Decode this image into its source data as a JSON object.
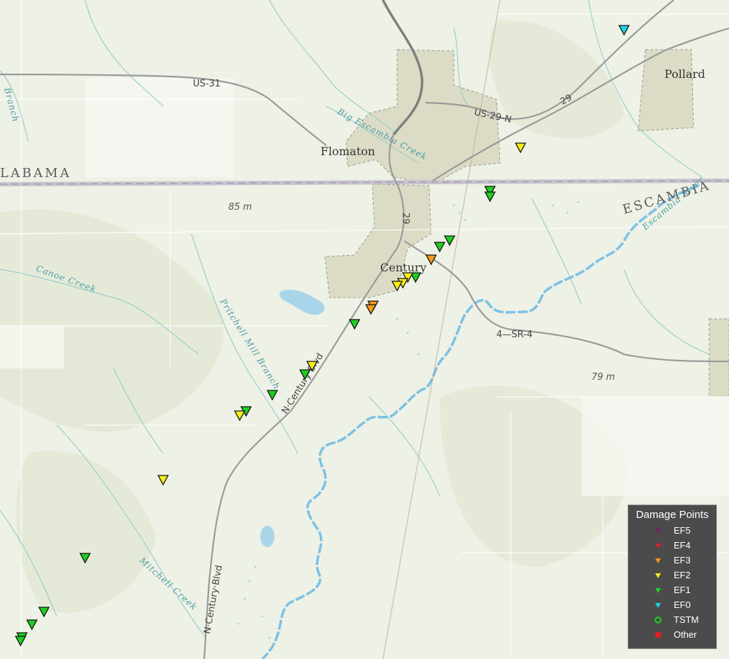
{
  "map": {
    "places": {
      "pollard": "Pollard",
      "flomaton": "Flomaton",
      "century": "Century",
      "state_label": "LABAMA",
      "escambia_county": "ESCAMBIA"
    },
    "roads": {
      "us31": "US-31",
      "us29n": "US-29-N",
      "r29_ne": "29",
      "r29_s": "29",
      "sr4": "4—SR-4",
      "n_century_blvd_1": "N·Century·Blvd",
      "n_century_blvd_2": "N·Century·Blvd"
    },
    "water": {
      "big_escambia_creek": "Big Escambia Creek",
      "canoe_creek": "Canoe Creek",
      "pritchell_mill_branch": "Pritchell Mill Branch",
      "mitchell_creek": "Mitchell Creek",
      "escambia_river": "Escambia River",
      "branch": "Branch"
    },
    "elevations": {
      "e85": "85 m",
      "e79": "79 m"
    }
  },
  "legend": {
    "title": "Damage Points",
    "items": [
      {
        "label": "EF5",
        "color": "#7b1f5f",
        "shape": "triangle"
      },
      {
        "label": "EF4",
        "color": "#e0201e",
        "shape": "triangle"
      },
      {
        "label": "EF3",
        "color": "#f59a19",
        "shape": "triangle"
      },
      {
        "label": "EF2",
        "color": "#f5ee19",
        "shape": "triangle"
      },
      {
        "label": "EF1",
        "color": "#1fce20",
        "shape": "triangle"
      },
      {
        "label": "EF0",
        "color": "#19d6e6",
        "shape": "triangle"
      },
      {
        "label": "TSTM",
        "color": "#19d61f",
        "shape": "ring"
      },
      {
        "label": "Other",
        "color": "#e0201e",
        "shape": "dot"
      }
    ]
  },
  "damage_points": [
    {
      "rating": "EF0"
    },
    {
      "rating": "EF2"
    },
    {
      "rating": "EF1"
    },
    {
      "rating": "EF1"
    },
    {
      "rating": "EF1"
    },
    {
      "rating": "EF1"
    },
    {
      "rating": "EF3"
    },
    {
      "rating": "EF1"
    },
    {
      "rating": "EF2"
    },
    {
      "rating": "EF2"
    },
    {
      "rating": "EF2"
    },
    {
      "rating": "EF3"
    },
    {
      "rating": "EF3"
    },
    {
      "rating": "EF1"
    },
    {
      "rating": "EF2"
    },
    {
      "rating": "EF1"
    },
    {
      "rating": "EF1"
    },
    {
      "rating": "EF1"
    },
    {
      "rating": "EF2"
    },
    {
      "rating": "EF2"
    },
    {
      "rating": "EF1"
    },
    {
      "rating": "EF1"
    },
    {
      "rating": "EF1"
    },
    {
      "rating": "EF1"
    },
    {
      "rating": "EF1"
    }
  ]
}
